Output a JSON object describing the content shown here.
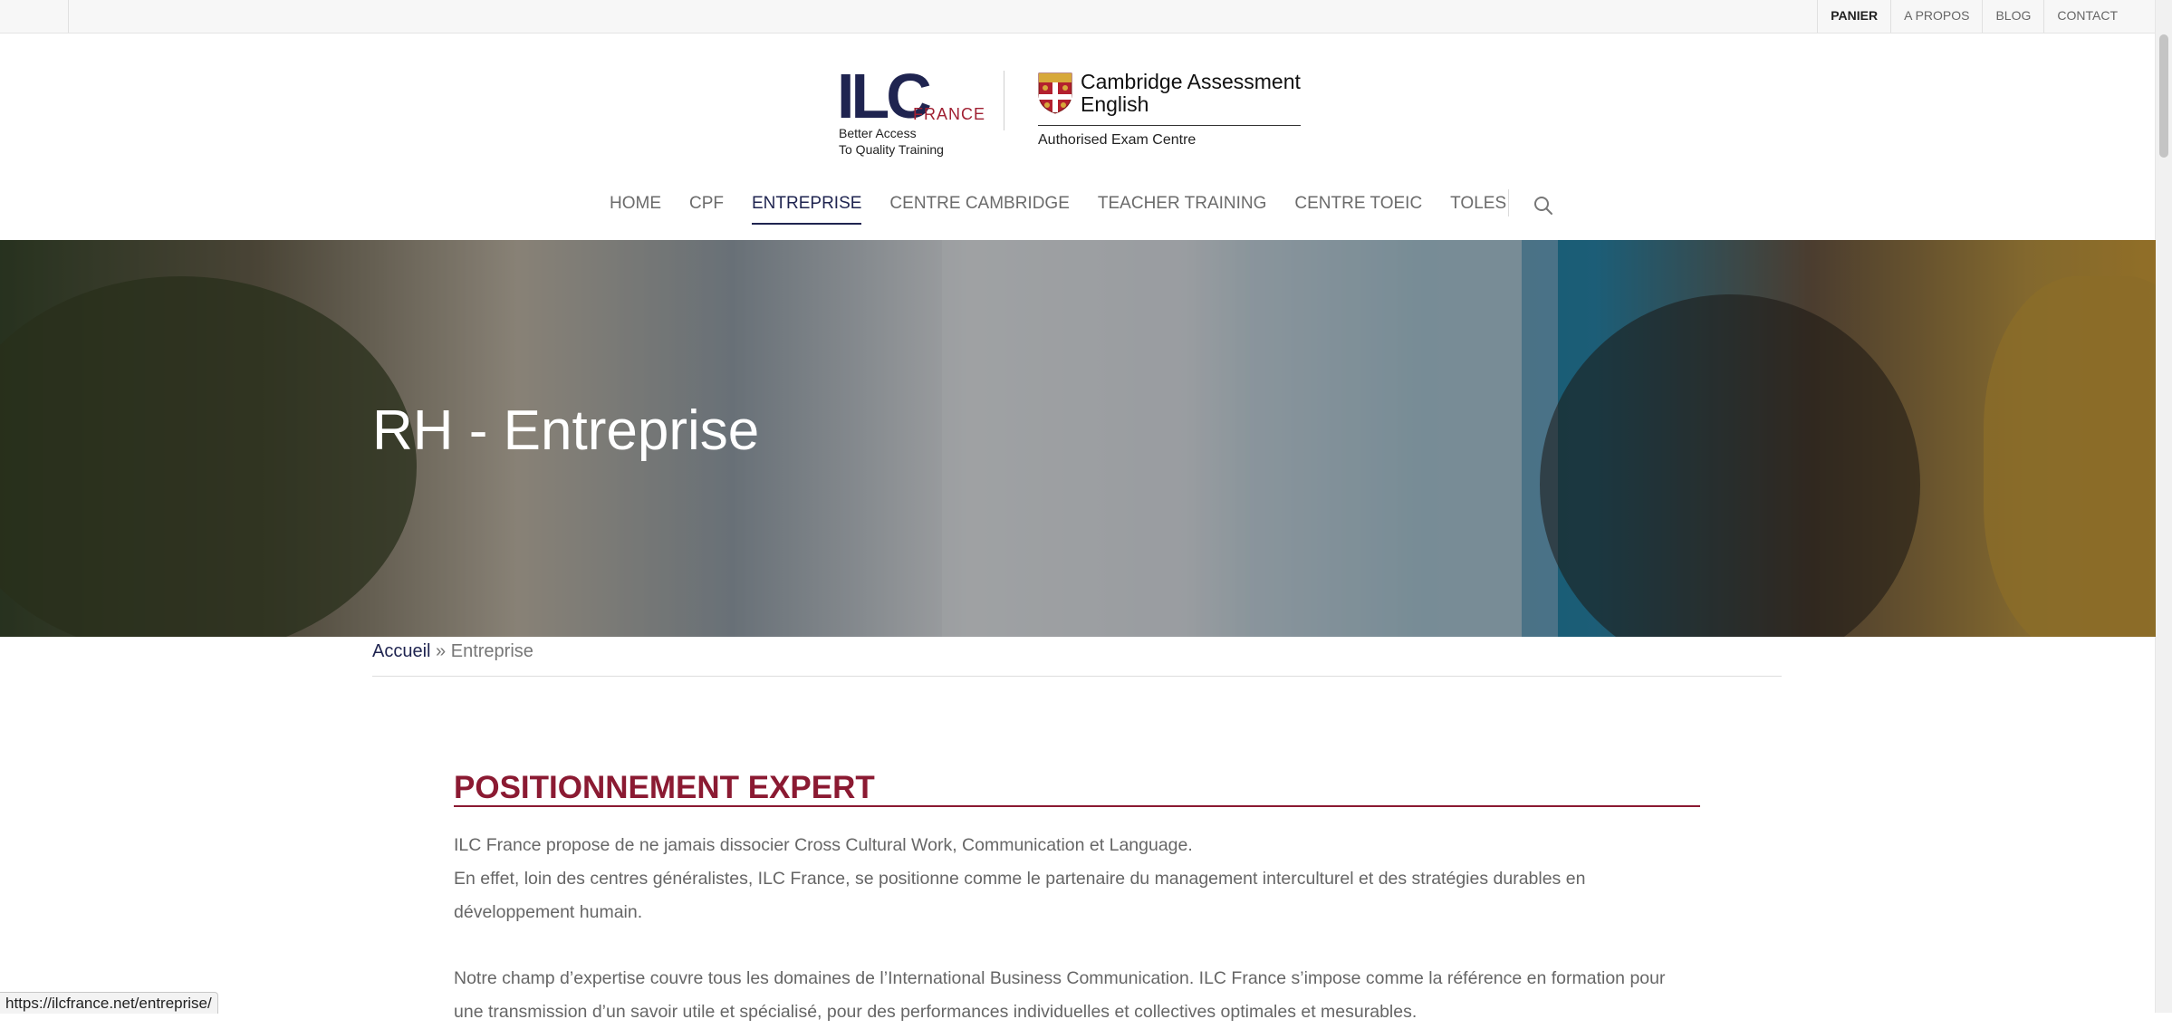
{
  "topbar": {
    "links": [
      "PANIER",
      "A PROPOS",
      "BLOG",
      "CONTACT"
    ]
  },
  "logo": {
    "ilc": "ILC",
    "france": "FRANCE",
    "tagline_1": "Better Access",
    "tagline_2": "To Quality Training",
    "cambridge_1": "Cambridge Assessment",
    "cambridge_2": "English",
    "cambridge_sub": "Authorised Exam Centre"
  },
  "nav": {
    "items": [
      "HOME",
      "CPF",
      "ENTREPRISE",
      "CENTRE CAMBRIDGE",
      "TEACHER TRAINING",
      "CENTRE TOEIC",
      "TOLES"
    ],
    "active": "ENTREPRISE"
  },
  "hero": {
    "title": "RH - Entreprise"
  },
  "breadcrumb": {
    "home": "Accueil",
    "sep": " » ",
    "current": "Entreprise"
  },
  "content": {
    "heading": "POSITIONNEMENT EXPERT",
    "p1_line1": "ILC France propose de ne jamais dissocier Cross Cultural Work, Communication et Language.",
    "p1_line2": "En effet, loin des centres généralistes, ILC France, se positionne comme le partenaire du management interculturel et des stratégies durables en développement humain.",
    "p2": "Notre champ d’expertise couvre tous les domaines de l’International Business Communication. ILC France s’impose comme la référence en formation pour une transmission d’un savoir utile et spécialisé, pour des performances individuelles et collectives optimales et mesurables."
  },
  "status": {
    "url": "https://ilcfrance.net/entreprise/"
  },
  "colors": {
    "brand_navy": "#1f2450",
    "brand_red": "#8b1a32"
  }
}
